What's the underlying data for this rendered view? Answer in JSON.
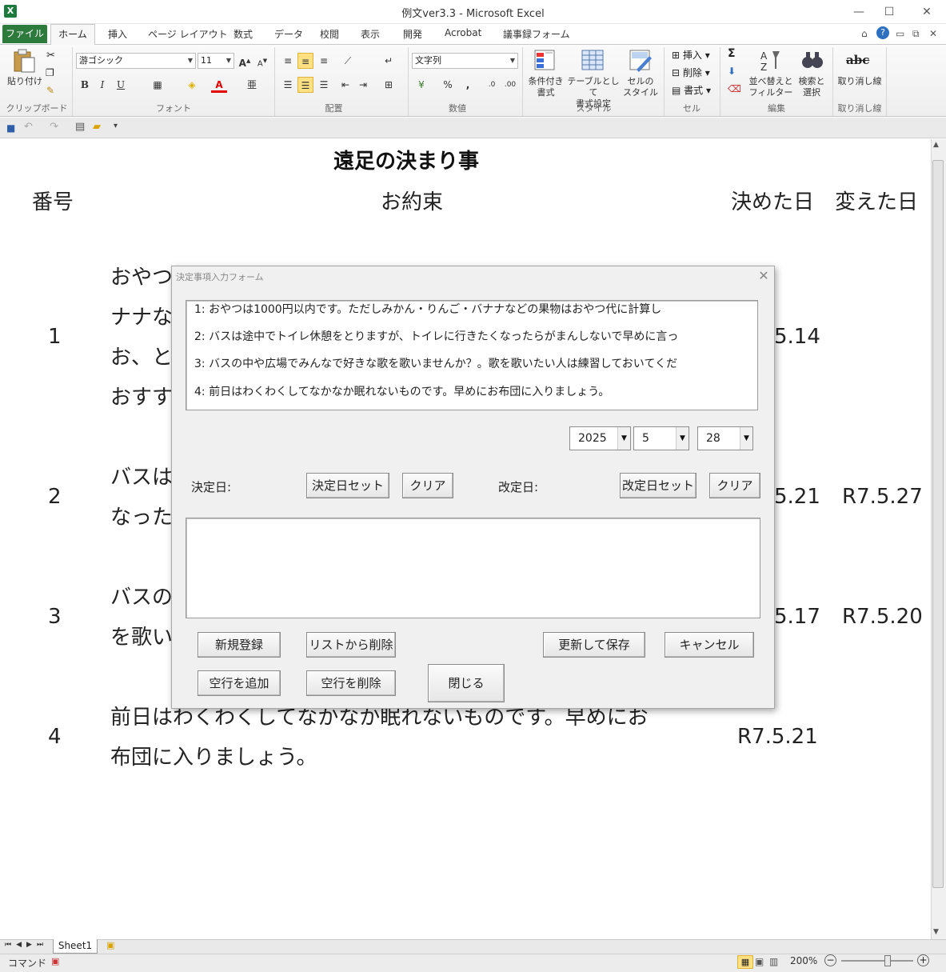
{
  "window": {
    "title": "例文ver3.3 - Microsoft Excel",
    "app_icon": "X",
    "controls": {
      "minimize": "—",
      "maximize": "☐",
      "close": "✕"
    }
  },
  "ribbon_tabs": {
    "file": "ファイル",
    "home": "ホーム",
    "items": [
      "挿入",
      "ページ レイアウト",
      "数式",
      "データ",
      "校閲",
      "表示",
      "開発",
      "Acrobat",
      "議事録フォーム"
    ]
  },
  "ribbon": {
    "clipboard": {
      "paste_label": "貼り付け",
      "group": "クリップボード"
    },
    "font": {
      "name": "游ゴシック",
      "size": "11",
      "group": "フォント",
      "bold": "B",
      "italic": "I",
      "underline": "U",
      "grow": "A",
      "shrink": "A",
      "color_a": "A"
    },
    "alignment": {
      "group": "配置"
    },
    "number": {
      "format": "文字列",
      "group": "数値",
      "percent": "%",
      "comma": ","
    },
    "styles": {
      "group": "スタイル",
      "cond_fmt": [
        "条件付き",
        "書式"
      ],
      "table_fmt": [
        "テーブルとして",
        "書式設定"
      ],
      "cell_style": [
        "セルの",
        "スタイル"
      ]
    },
    "cells": {
      "group": "セル",
      "insert": "挿入",
      "delete": "削除",
      "format": "書式"
    },
    "editing": {
      "group": "編集",
      "sort": [
        "並べ替えと",
        "フィルター"
      ],
      "find": [
        "検索と",
        "選択"
      ],
      "sigma": "Σ"
    },
    "strike": {
      "group": "取り消し線",
      "label": "取り消し線",
      "icon_text": "abc"
    }
  },
  "sheet": {
    "title": "遠足の決まり事",
    "headers": {
      "num": "番号",
      "promise": "お約束",
      "decided": "決めた日",
      "changed": "変えた日"
    },
    "rows": [
      {
        "num": "1",
        "lines": [
          "おやつ",
          "ナナな",
          "お、と",
          "おすす"
        ],
        "decided": "5.14",
        "changed": ""
      },
      {
        "num": "2",
        "lines": [
          "バスは",
          "なった"
        ],
        "decided": "5.21",
        "changed": "R7.5.27"
      },
      {
        "num": "3",
        "lines": [
          "バスの",
          "を歌い"
        ],
        "decided": "5.17",
        "changed": "R7.5.20"
      },
      {
        "num": "4",
        "lines": [
          "前日はわくわくしてなかなか眠れないものです。早めにお",
          "布団に入りましょう。"
        ],
        "decided": "R7.5.21",
        "changed": ""
      }
    ]
  },
  "sheet_tabs": {
    "active": "Sheet1"
  },
  "statusbar": {
    "mode": "コマンド",
    "zoom": "200%"
  },
  "dialog": {
    "title": "決定事項入力フォーム",
    "list_items": [
      "1: おやつは1000円以内です。ただしみかん・りんご・バナナなどの果物はおやつ代に計算し",
      "2: バスは途中でトイレ休憩をとりますが、トイレに行きたくなったらがまんしないで早めに言っ",
      "3: バスの中や広場でみんなで好きな歌を歌いませんか？。歌を歌いたい人は練習しておいてくだ",
      "4: 前日はわくわくしてなかなか眠れないものです。早めにお布団に入りましょう。"
    ],
    "year": "2025",
    "month": "5",
    "day": "28",
    "decided_label": "決定日:",
    "decided_set": "決定日セット",
    "decided_clear": "クリア",
    "revised_label": "改定日:",
    "revised_set": "改定日セット",
    "revised_clear": "クリア",
    "textarea_value": "",
    "btn_new": "新規登録",
    "btn_remove": "リストから削除",
    "btn_update": "更新して保存",
    "btn_cancel": "キャンセル",
    "btn_add_blank": "空行を追加",
    "btn_del_blank": "空行を削除",
    "btn_close": "閉じる"
  }
}
